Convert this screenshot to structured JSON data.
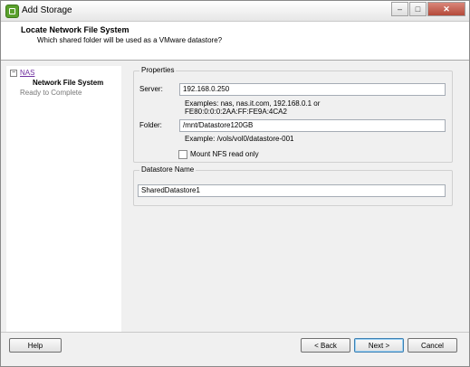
{
  "window": {
    "title": "Add Storage"
  },
  "header": {
    "title": "Locate Network File System",
    "subtitle": "Which shared folder will be used as a VMware datastore?"
  },
  "nav": {
    "expander": "⊟",
    "items": [
      {
        "label": "NAS"
      },
      {
        "label": "Network File System"
      },
      {
        "label": "Ready to Complete"
      }
    ]
  },
  "properties": {
    "legend": "Properties",
    "server_label": "Server:",
    "server_value": "192.168.0.250",
    "server_hint_line1": "Examples: nas, nas.it.com, 192.168.0.1 or",
    "server_hint_line2": "FE80:0:0:0:2AA:FF:FE9A:4CA2",
    "folder_label": "Folder:",
    "folder_value": "/mnt/Datastore120GB",
    "folder_hint": "Example: /vols/vol0/datastore-001",
    "readonly_label": "Mount NFS read only",
    "readonly_checked": false
  },
  "datastore": {
    "legend": "Datastore Name",
    "value": "SharedDatastore1"
  },
  "buttons": {
    "help": "Help",
    "back": "< Back",
    "next": "Next >",
    "cancel": "Cancel"
  }
}
